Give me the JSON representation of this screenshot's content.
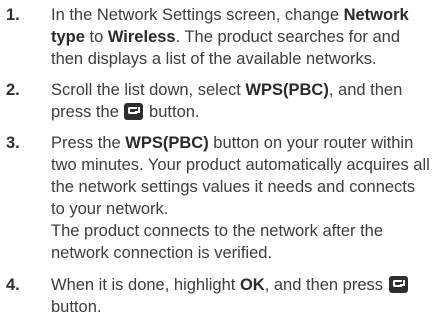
{
  "steps": [
    {
      "number": "1.",
      "line1_pre": "In the Network Settings screen, change ",
      "line1_bold": "Network",
      "line2_bold_a": "type",
      "line2_mid": " to ",
      "line2_bold_b": "Wireless",
      "line2_post": ". The product searches for and",
      "line3": "then displays a list of the available networks."
    },
    {
      "number": "2.",
      "line1_pre": "Scroll the list down, select ",
      "line1_bold": "WPS(PBC)",
      "line1_post": ", and then",
      "line2_pre": "press the ",
      "line2_post": " button.",
      "icon": "enter-button-icon"
    },
    {
      "number": "3.",
      "line1_pre": "Press the ",
      "line1_bold": "WPS(PBC)",
      "line1_post": " button on your router within",
      "line2": "two minutes. Your product automatically acquires all",
      "line3": "the network settings values it needs and connects",
      "line4": "to your network.",
      "line5": "The product connects to the network after the",
      "line6": "network connection is verified."
    },
    {
      "number": "4.",
      "line1_pre": "When it is done, highlight ",
      "line1_bold": "OK",
      "line1_post": ", and then press ",
      "line2": "button.",
      "icon": "enter-button-icon"
    }
  ]
}
